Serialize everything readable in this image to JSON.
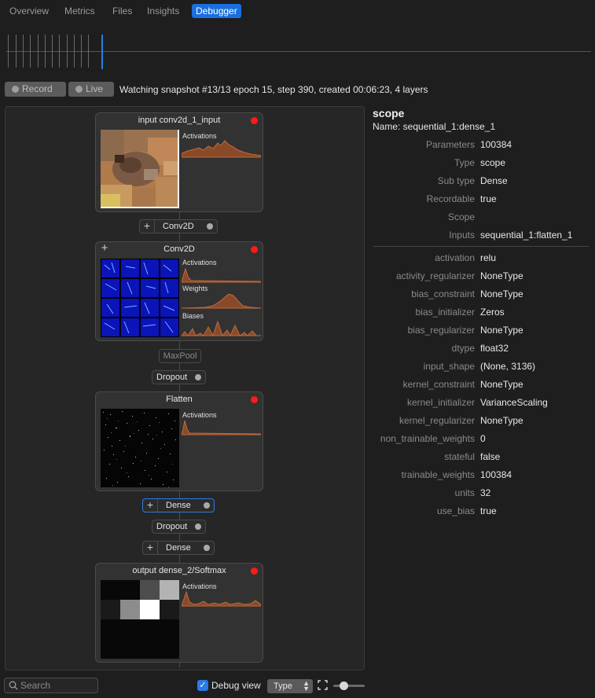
{
  "tabs": [
    {
      "label": "Overview",
      "active": false
    },
    {
      "label": "Metrics",
      "active": false
    },
    {
      "label": "Files",
      "active": false
    },
    {
      "label": "Insights",
      "active": false
    },
    {
      "label": "Debugger",
      "active": true
    }
  ],
  "timeline": {
    "snapshot_count": 13,
    "current": 13
  },
  "record_bar": {
    "record_label": "Record",
    "live_label": "Live",
    "status": "Watching snapshot #13/13 epoch 15, step 390, created 00:06:23, 4 layers"
  },
  "graph": {
    "nodes": {
      "input": {
        "title": "input conv2d_1_input",
        "hist1": "Activations"
      },
      "conv": {
        "title": "Conv2D",
        "hist1": "Activations",
        "hist2": "Weights",
        "hist3": "Biases"
      },
      "flatten": {
        "title": "Flatten",
        "hist1": "Activations"
      },
      "output": {
        "title": "output dense_2/Softmax",
        "hist1": "Activations"
      }
    },
    "pills": {
      "conv2d": "Conv2D",
      "maxpool": "MaxPool",
      "dropout1": "Dropout",
      "dense1": "Dense",
      "dropout2": "Dropout",
      "dense2": "Dense"
    },
    "output_grid": [
      0.03,
      0.03,
      0.3,
      0.7,
      0.1,
      0.55,
      1.0,
      0.1,
      0.03,
      0.03,
      0.03,
      0.03,
      0.03,
      0.03,
      0.03,
      0.03
    ]
  },
  "details": {
    "title": "scope",
    "name": "Name: sequential_1:dense_1",
    "header_props": [
      {
        "key": "Parameters",
        "value": "100384"
      },
      {
        "key": "Type",
        "value": "scope"
      },
      {
        "key": "Sub type",
        "value": "Dense"
      },
      {
        "key": "Recordable",
        "value": "true"
      },
      {
        "key": "Scope",
        "value": ""
      },
      {
        "key": "Inputs",
        "value": "sequential_1:flatten_1"
      }
    ],
    "config_props": [
      {
        "key": "activation",
        "value": "relu"
      },
      {
        "key": "activity_regularizer",
        "value": "NoneType"
      },
      {
        "key": "bias_constraint",
        "value": "NoneType"
      },
      {
        "key": "bias_initializer",
        "value": "Zeros"
      },
      {
        "key": "bias_regularizer",
        "value": "NoneType"
      },
      {
        "key": "dtype",
        "value": "float32"
      },
      {
        "key": "input_shape",
        "value": "(None, 3136)"
      },
      {
        "key": "kernel_constraint",
        "value": "NoneType"
      },
      {
        "key": "kernel_initializer",
        "value": "VarianceScaling"
      },
      {
        "key": "kernel_regularizer",
        "value": "NoneType"
      },
      {
        "key": "non_trainable_weights",
        "value": "0"
      },
      {
        "key": "stateful",
        "value": "false"
      },
      {
        "key": "trainable_weights",
        "value": "100384"
      },
      {
        "key": "units",
        "value": "32"
      },
      {
        "key": "use_bias",
        "value": "true"
      }
    ]
  },
  "bottom": {
    "search_placeholder": "Search",
    "debug_view_label": "Debug view",
    "debug_view_checked": true,
    "type_select": "Type",
    "zoom_level": 0.33
  },
  "colors": {
    "accent": "#1a6fe0",
    "record": "#ff1a1a",
    "histogram": "#a0522d"
  },
  "icons": [
    "plus-icon",
    "record-dot-icon",
    "search-icon",
    "checkmark-icon",
    "chevron-updown-icon",
    "fullscreen-icon"
  ]
}
